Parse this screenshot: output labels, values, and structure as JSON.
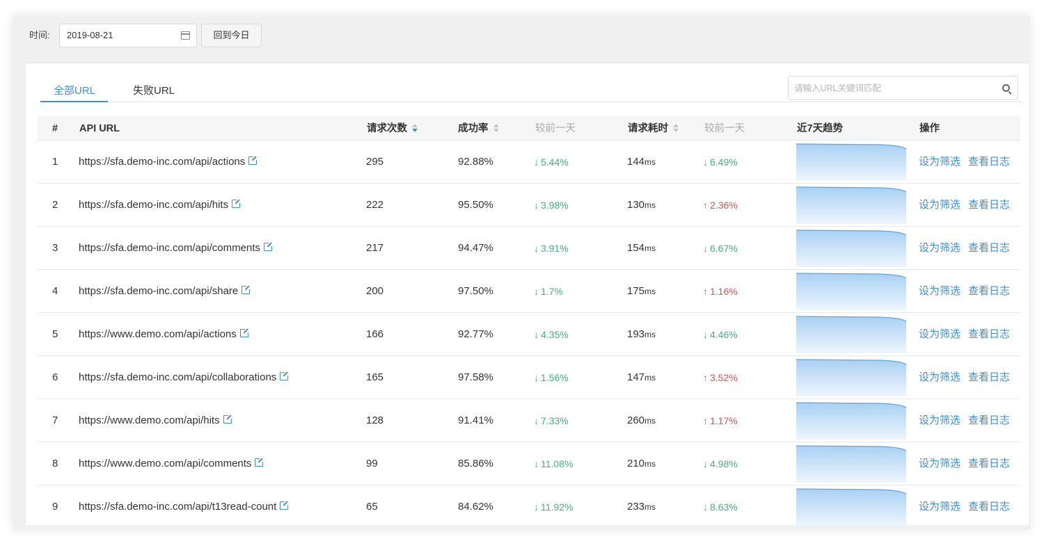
{
  "filter": {
    "time_label": "时间:",
    "date_value": "2019-08-21",
    "today_button": "回到今日"
  },
  "tabs": [
    {
      "label": "全部URL",
      "active": true
    },
    {
      "label": "失败URL",
      "active": false
    }
  ],
  "search": {
    "placeholder": "请输入URL关键词匹配",
    "icon": "search-icon"
  },
  "table": {
    "headers": {
      "index": "#",
      "url": "API URL",
      "requests": "请求次数",
      "success_rate": "成功率",
      "success_vs_prev": "较前一天",
      "latency": "请求耗时",
      "latency_vs_prev": "较前一天",
      "trend": "近7天趋势",
      "actions": "操作"
    },
    "latency_unit": "ms",
    "action_filter": "设为筛选",
    "action_logs": "查看日志",
    "rows": [
      {
        "idx": "1",
        "url": "https://sfa.demo-inc.com/api/actions",
        "requests": "295",
        "success": "92.88%",
        "success_chg": "5.44%",
        "success_dir": "down",
        "latency": "144",
        "latency_chg": "6.49%",
        "latency_dir": "down"
      },
      {
        "idx": "2",
        "url": "https://sfa.demo-inc.com/api/hits",
        "requests": "222",
        "success": "95.50%",
        "success_chg": "3.98%",
        "success_dir": "down",
        "latency": "130",
        "latency_chg": "2.36%",
        "latency_dir": "up"
      },
      {
        "idx": "3",
        "url": "https://sfa.demo-inc.com/api/comments",
        "requests": "217",
        "success": "94.47%",
        "success_chg": "3.91%",
        "success_dir": "down",
        "latency": "154",
        "latency_chg": "6.67%",
        "latency_dir": "down"
      },
      {
        "idx": "4",
        "url": "https://sfa.demo-inc.com/api/share",
        "requests": "200",
        "success": "97.50%",
        "success_chg": "1.7%",
        "success_dir": "down",
        "latency": "175",
        "latency_chg": "1.16%",
        "latency_dir": "up"
      },
      {
        "idx": "5",
        "url": "https://www.demo.com/api/actions",
        "requests": "166",
        "success": "92.77%",
        "success_chg": "4.35%",
        "success_dir": "down",
        "latency": "193",
        "latency_chg": "4.46%",
        "latency_dir": "down"
      },
      {
        "idx": "6",
        "url": "https://sfa.demo-inc.com/api/collaborations",
        "requests": "165",
        "success": "97.58%",
        "success_chg": "1.56%",
        "success_dir": "down",
        "latency": "147",
        "latency_chg": "3.52%",
        "latency_dir": "up"
      },
      {
        "idx": "7",
        "url": "https://www.demo.com/api/hits",
        "requests": "128",
        "success": "91.41%",
        "success_chg": "7.33%",
        "success_dir": "down",
        "latency": "260",
        "latency_chg": "1.17%",
        "latency_dir": "up"
      },
      {
        "idx": "8",
        "url": "https://www.demo.com/api/comments",
        "requests": "99",
        "success": "85.86%",
        "success_chg": "11.08%",
        "success_dir": "down",
        "latency": "210",
        "latency_chg": "4.98%",
        "latency_dir": "down"
      },
      {
        "idx": "9",
        "url": "https://sfa.demo-inc.com/api/t13read-count",
        "requests": "65",
        "success": "84.62%",
        "success_chg": "11.92%",
        "success_dir": "down",
        "latency": "233",
        "latency_chg": "8.63%",
        "latency_dir": "down"
      }
    ]
  },
  "colors": {
    "accent": "#3d8fdd",
    "down": "#3fb27f",
    "up": "#e1504d"
  }
}
